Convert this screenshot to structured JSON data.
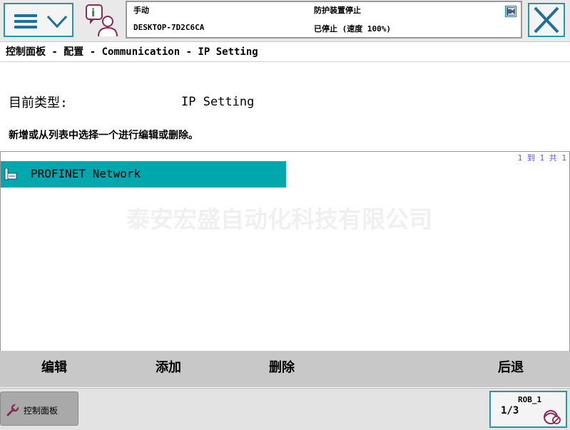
{
  "header": {
    "mode": "手动",
    "host": "DESKTOP-7D2C6CA",
    "guard_status": "防护装置停止",
    "run_status": "已停止 (速度 100%)"
  },
  "breadcrumb": "控制面板 - 配置 - Communication - IP Setting",
  "content": {
    "type_label": "目前类型:",
    "type_value": "IP Setting",
    "instruction": "新增或从列表中选择一个进行编辑或删除。",
    "paging": "1 到 1 共 1",
    "items": [
      {
        "label": "PROFINET Network",
        "selected": true
      }
    ],
    "watermark": "泰安宏盛自动化科技有限公司"
  },
  "commands": {
    "edit": "编辑",
    "add": "添加",
    "delete": "删除",
    "back": "后退"
  },
  "taskbar": {
    "tab_label": "控制面板",
    "robot_name": "ROB_1",
    "speed_fraction": "1/3"
  },
  "icons": {
    "menu": "hamburger-menu-icon",
    "chevron": "chevron-down-icon",
    "info": "info-person-icon",
    "alert": "event-log-icon",
    "close": "close-icon",
    "list_item": "network-config-icon",
    "tab": "wrench-icon",
    "run": "run-mode-icon"
  },
  "colors": {
    "accent": "#1d9aa3",
    "selection": "#00a7ad",
    "paging_text": "#5a5adc"
  }
}
